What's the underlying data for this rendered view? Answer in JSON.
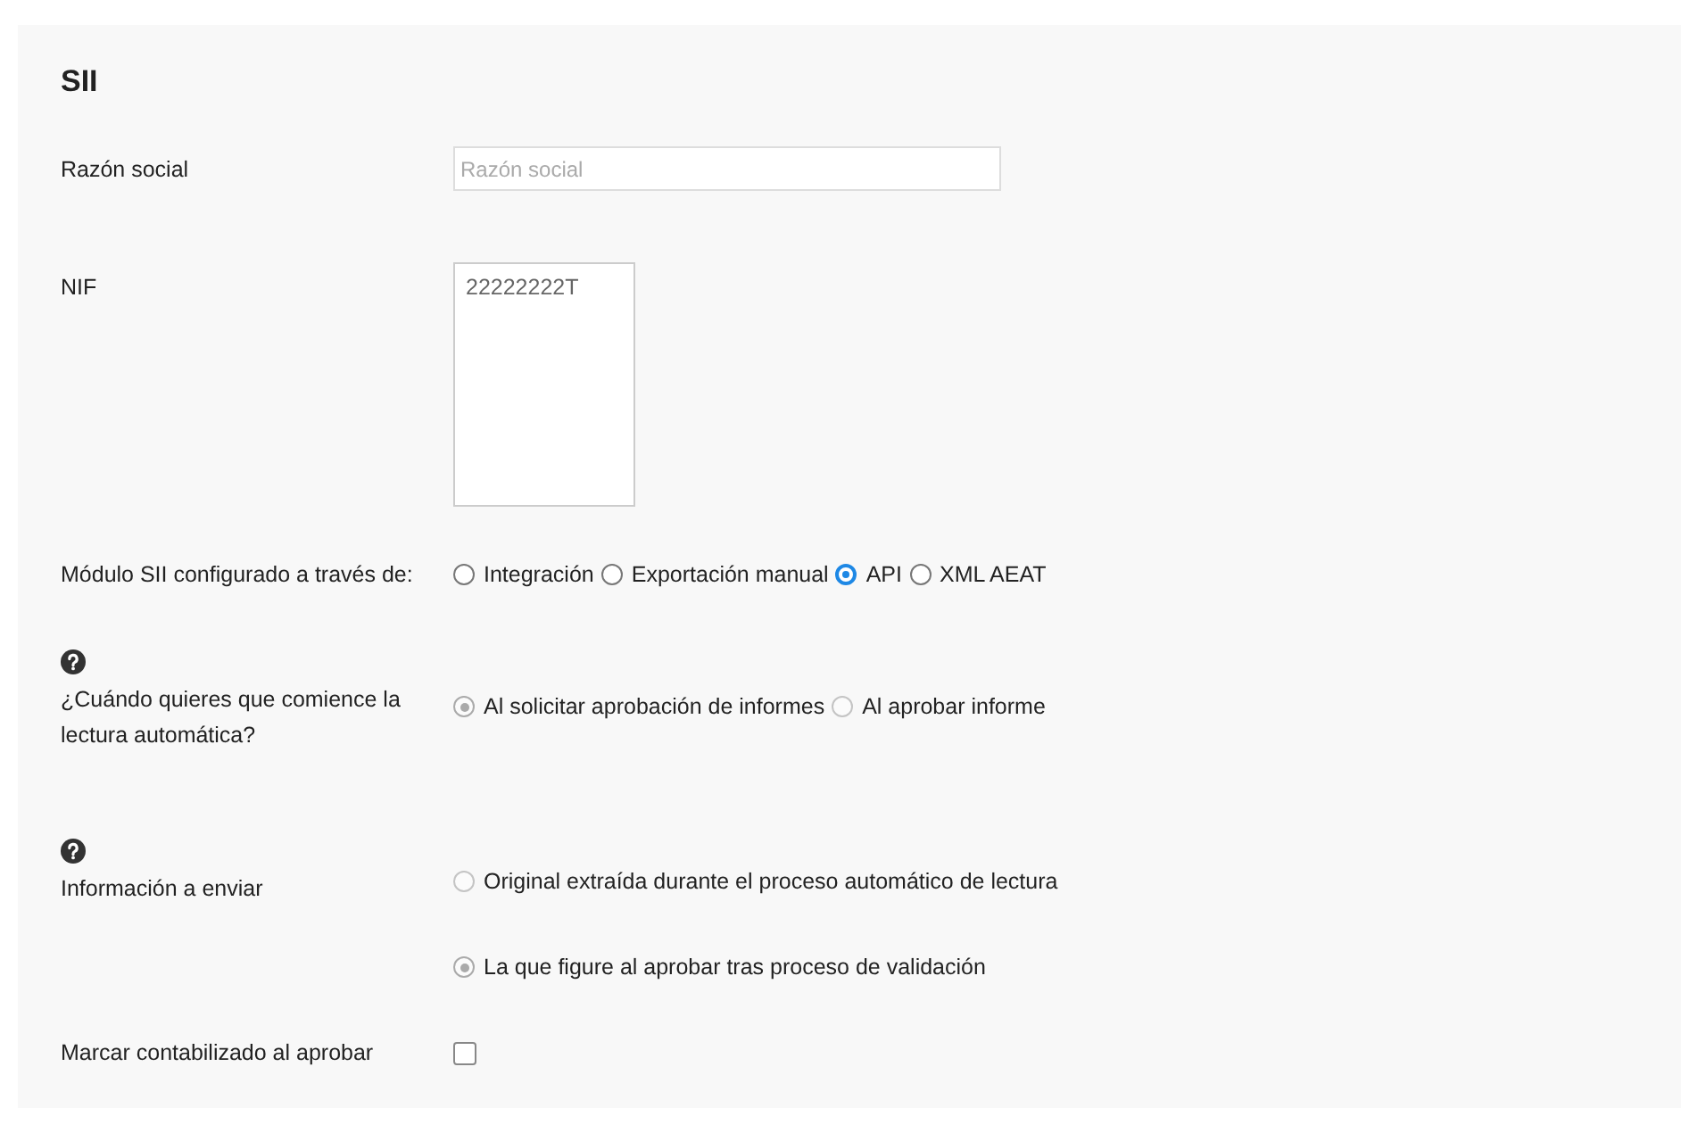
{
  "title": "SII",
  "fields": [
    {
      "label": "Razón social",
      "kind": "text",
      "placeholder": "Razón social"
    },
    {
      "label": "NIF",
      "kind": "textarea",
      "value": "22222222T"
    }
  ],
  "radio_groups": [
    {
      "label": "Módulo SII configurado a través de:",
      "help": false,
      "disabled": false,
      "kind": "inline",
      "options": [
        {
          "label": "Integración",
          "selected": false
        },
        {
          "label": "Exportación manual",
          "selected": false
        },
        {
          "label": "API",
          "selected": true
        },
        {
          "label": "XML AEAT",
          "selected": false
        }
      ]
    },
    {
      "label": "¿Cuándo quieres que comience la lectura automática?",
      "help": true,
      "disabled": true,
      "kind": "inline",
      "options": [
        {
          "label": "Al solicitar aprobación de informes",
          "selected": true
        },
        {
          "label": "Al aprobar informe",
          "selected": false
        }
      ]
    },
    {
      "label": "Información a enviar",
      "help": true,
      "disabled": true,
      "kind": "stacked",
      "options": [
        {
          "label": "Original extraída durante el proceso automático de lectura",
          "selected": false
        },
        {
          "label": "La que figure al aprobar tras proceso de validación",
          "selected": true
        }
      ]
    }
  ],
  "checkbox": {
    "label": "Marcar contabilizado al aprobar",
    "checked": false
  }
}
